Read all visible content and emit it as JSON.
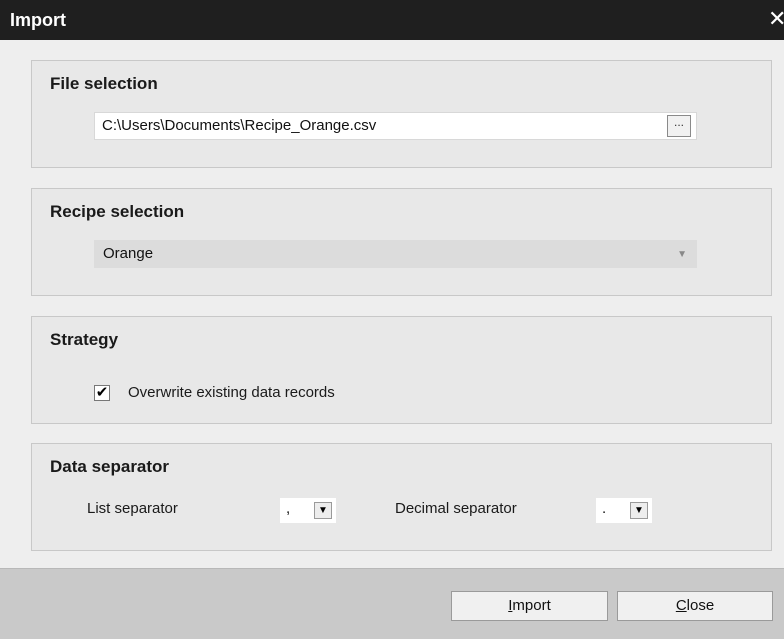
{
  "window": {
    "title": "Import",
    "close_glyph": "✕"
  },
  "file_section": {
    "title": "File selection",
    "path_value": "C:\\Users\\Documents\\Recipe_Orange.csv",
    "browse_label": "..."
  },
  "recipe_section": {
    "title": "Recipe selection",
    "selected": "Orange",
    "arrow": "▼"
  },
  "strategy_section": {
    "title": "Strategy",
    "checkbox_checked": true,
    "checkbox_mark": "✔",
    "checkbox_label": "Overwrite existing data records"
  },
  "separator_section": {
    "title": "Data separator",
    "list_label": "List separator",
    "list_value": ",",
    "decimal_label": "Decimal separator",
    "decimal_value": ".",
    "arrow": "▼"
  },
  "footer": {
    "import_button": {
      "first": "I",
      "rest": "mport"
    },
    "close_button": {
      "first": "C",
      "rest": "lose"
    }
  }
}
